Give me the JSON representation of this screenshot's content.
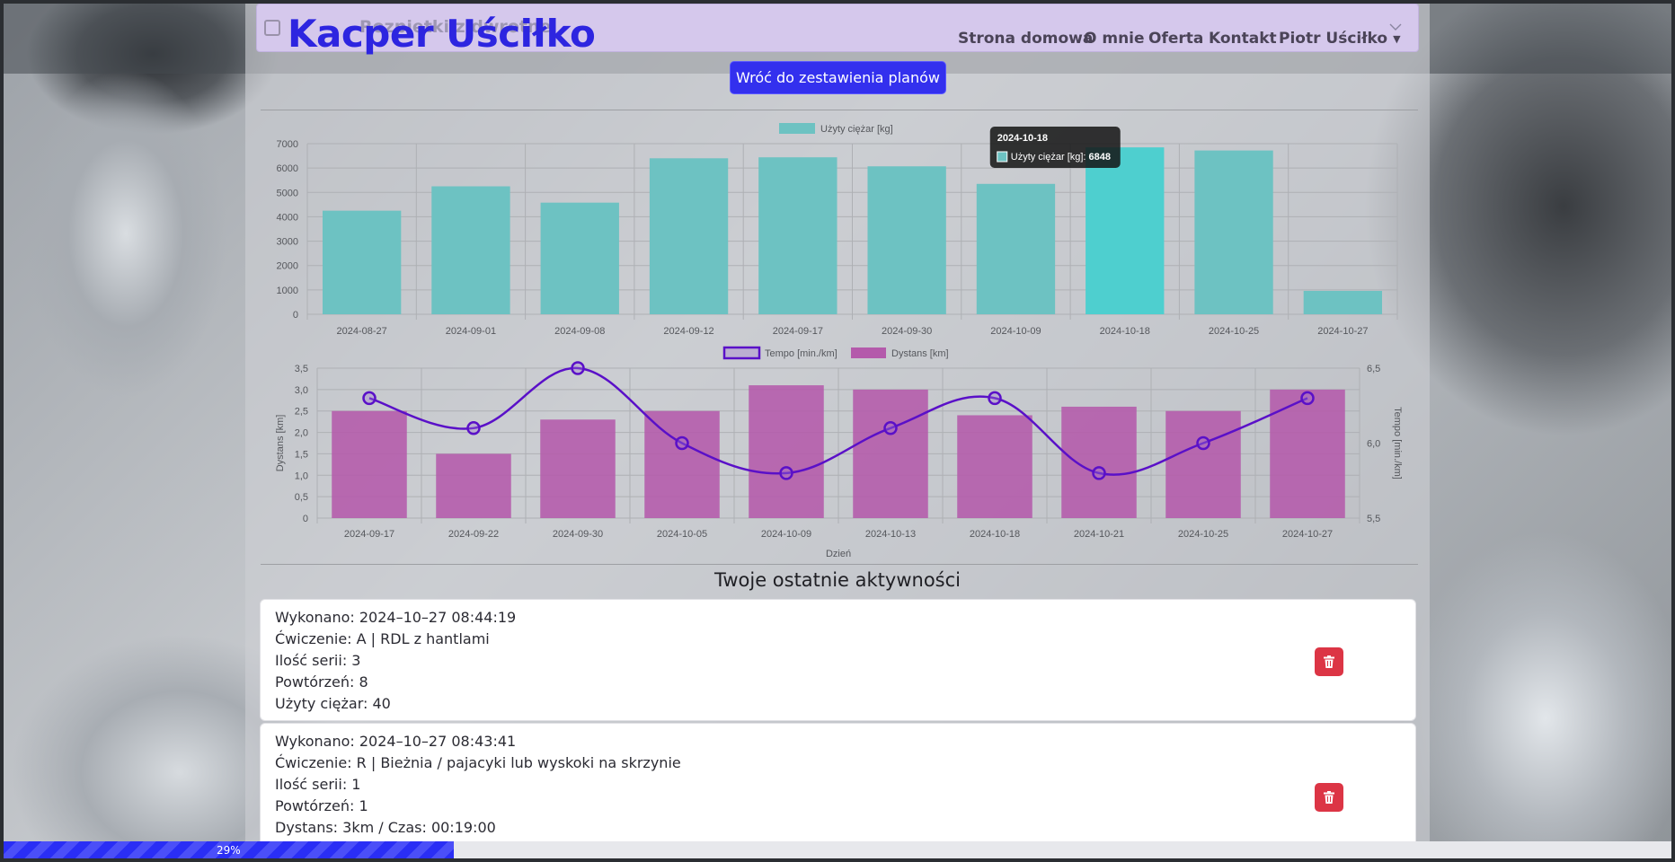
{
  "navbar": {
    "brand": "Kacper Uściłko",
    "ghost_text": "Rozpiętki z dwrotne",
    "links": [
      "Strona domowa",
      "O mnie",
      "Oferta",
      "Kontakt"
    ],
    "user_menu": "Piotr Uściłko"
  },
  "back_button": "Wróć do zestawienia planów",
  "weight_chart": {
    "type": "bar",
    "categories": [
      "2024-08-27",
      "2024-09-01",
      "2024-09-08",
      "2024-09-12",
      "2024-09-17",
      "2024-09-30",
      "2024-10-09",
      "2024-10-18",
      "2024-10-25",
      "2024-10-27"
    ],
    "series": [
      {
        "name": "Użyty ciężar [kg]",
        "values": [
          4250,
          5250,
          4580,
          6400,
          6440,
          6070,
          5350,
          6848,
          6720,
          960
        ]
      }
    ],
    "ylim": [
      0,
      7000
    ],
    "yticks": [
      "0",
      "1000",
      "2000",
      "3000",
      "4000",
      "5000",
      "6000",
      "7000"
    ],
    "color": "#6dc2c2",
    "hover_color": "#4ecfcf",
    "tooltip": {
      "title": "2024-10-18",
      "label": "Użyty ciężar [kg]",
      "value": "6848"
    },
    "hover_index": 7
  },
  "run_chart": {
    "type": "bar+line",
    "categories": [
      "2024-09-17",
      "2024-09-22",
      "2024-09-30",
      "2024-10-05",
      "2024-10-09",
      "2024-10-13",
      "2024-10-18",
      "2024-10-21",
      "2024-10-25",
      "2024-10-27"
    ],
    "distance": {
      "name": "Dystans [km]",
      "values": [
        2.5,
        1.5,
        2.3,
        2.5,
        3.1,
        3.0,
        2.4,
        2.6,
        2.5,
        3.0
      ],
      "color": "#b45aab"
    },
    "tempo": {
      "name": "Tempo [min./km]",
      "values": [
        6.3,
        6.1,
        6.5,
        6.0,
        5.8,
        6.1,
        6.3,
        5.8,
        6.0,
        6.3
      ],
      "color": "#5a10c8"
    },
    "left_ylim": [
      0,
      3.5
    ],
    "left_ticks": [
      "0",
      "0,5",
      "1,0",
      "1,5",
      "2,0",
      "2,5",
      "3,0",
      "3,5"
    ],
    "right_ylim": [
      5.5,
      6.5
    ],
    "right_ticks": [
      "5,5",
      "6,0",
      "6,5"
    ],
    "ylabel_left": "Dystans [km]",
    "ylabel_right": "Tempo [min./km]",
    "xlabel": "Dzień"
  },
  "recent": {
    "title": "Twoje ostatnie aktywności",
    "cards": [
      {
        "lines": [
          "Wykonano: 2024–10–27 08:44:19",
          "Ćwiczenie: A | RDL z hantlami",
          "Ilość serii: 3",
          "Powtórzeń: 8",
          "Użyty ciężar: 40"
        ]
      },
      {
        "lines": [
          "Wykonano: 2024–10–27 08:43:41",
          "Ćwiczenie: R | Bieżnia / pajacyki lub wyskoki na skrzynie",
          "Ilość serii: 1",
          "Powtórzeń: 1",
          "Dystans: 3km / Czas: 00:19:00"
        ]
      }
    ]
  },
  "progress": {
    "label": "29%",
    "value": 0.29
  },
  "icons": {
    "delete": "trash-icon",
    "menu": "chevron-down-icon",
    "checkbox": "checkbox-icon"
  }
}
